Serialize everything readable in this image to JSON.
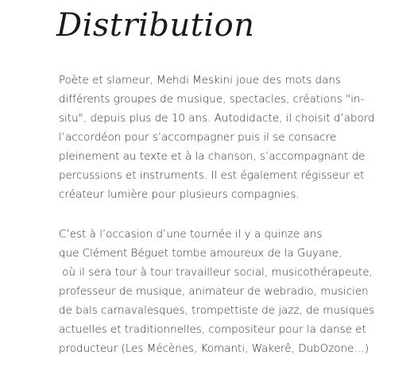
{
  "heading": "Distribution",
  "paragraphs": [
    {
      "lines": [
        "Poète et slameur, Mehdi Meskini joue des mots dans",
        "différents groupes de musique, spectacles, créations \"in-",
        "situ\", depuis plus de 10 ans. Autodidacte, il choisit d’abord",
        "l’accordéon pour s’accompagner puis il se consacre",
        "pleinement au texte et à la chanson, s’accompagnant de",
        "percussions et instruments. Il est également régisseur et",
        "créateur lumière pour plusieurs compagnies."
      ]
    },
    {
      "lines": [
        "C’est à l’occasion d’une tournée il y a quinze ans",
        "que Clément Béguet tombe amoureux de la Guyane,",
        " où il sera tour à tour travailleur social, musicothérapeute,",
        "professeur de musique, animateur de webradio, musicien",
        "de bals carnavalesques, trompettiste de jazz, de musiques",
        "actuelles et traditionnelles, compositeur pour la danse et",
        "producteur (Les Mécènes, Komanti, Wakerê, DubOzone…)"
      ]
    }
  ]
}
